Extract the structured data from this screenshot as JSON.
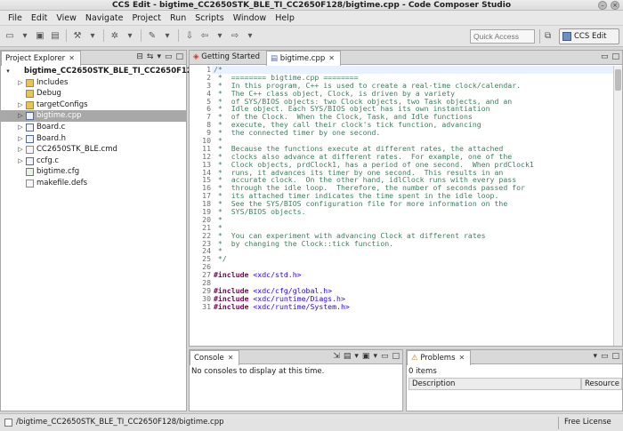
{
  "window": {
    "title": "CCS Edit - bigtime_CC2650STK_BLE_TI_CC2650F128/bigtime.cpp - Code Composer Studio"
  },
  "menu": [
    "File",
    "Edit",
    "View",
    "Navigate",
    "Project",
    "Run",
    "Scripts",
    "Window",
    "Help"
  ],
  "toolbar": {
    "quick_access_placeholder": "Quick Access",
    "perspective_label": "CCS Edit"
  },
  "project_explorer": {
    "tab_label": "Project Explorer",
    "items": [
      {
        "label": "bigtime_CC2650STK_BLE_TI_CC2650F128",
        "type": "project",
        "depth": 0,
        "expanded": true,
        "bold": true
      },
      {
        "label": "Includes",
        "type": "folder",
        "depth": 1,
        "expanded": false
      },
      {
        "label": "Debug",
        "type": "folder",
        "depth": 1,
        "expanded": null
      },
      {
        "label": "targetConfigs",
        "type": "folder",
        "depth": 1,
        "expanded": false
      },
      {
        "label": "bigtime.cpp",
        "type": "cfile",
        "depth": 1,
        "expanded": false,
        "selected": true
      },
      {
        "label": "Board.c",
        "type": "cfile",
        "depth": 1,
        "expanded": false
      },
      {
        "label": "Board.h",
        "type": "cfile",
        "depth": 1,
        "expanded": false
      },
      {
        "label": "CC2650STK_BLE.cmd",
        "type": "file",
        "depth": 1,
        "expanded": false
      },
      {
        "label": "ccfg.c",
        "type": "cfile",
        "depth": 1,
        "expanded": false
      },
      {
        "label": "bigtime.cfg",
        "type": "cfg",
        "depth": 1,
        "expanded": null
      },
      {
        "label": "makefile.defs",
        "type": "file",
        "depth": 1,
        "expanded": null
      }
    ]
  },
  "editor": {
    "tabs": [
      {
        "label": "Getting Started",
        "active": false
      },
      {
        "label": "bigtime.cpp",
        "active": true
      }
    ],
    "lines": [
      {
        "n": "1",
        "parts": [
          [
            "c",
            "/*"
          ]
        ]
      },
      {
        "n": "2",
        "parts": [
          [
            "c",
            " *  ======== bigtime.cpp ========"
          ]
        ]
      },
      {
        "n": "3",
        "parts": [
          [
            "c",
            " *  In this program, C++ is used to create a real-time clock/calendar."
          ]
        ]
      },
      {
        "n": "4",
        "parts": [
          [
            "c",
            " *  The C++ class object, Clock, is driven by a variety"
          ]
        ]
      },
      {
        "n": "5",
        "parts": [
          [
            "c",
            " *  of SYS/BIOS objects: two Clock objects, two Task objects, and an"
          ]
        ]
      },
      {
        "n": "6",
        "parts": [
          [
            "c",
            " *  Idle object. Each SYS/BIOS object has its own instantiation"
          ]
        ]
      },
      {
        "n": "7",
        "parts": [
          [
            "c",
            " *  of the Clock.  When the Clock, Task, and Idle functions"
          ]
        ]
      },
      {
        "n": "8",
        "parts": [
          [
            "c",
            " *  execute, they call their clock's tick function, advancing"
          ]
        ]
      },
      {
        "n": "9",
        "parts": [
          [
            "c",
            " *  the connected timer by one second."
          ]
        ]
      },
      {
        "n": "10",
        "parts": [
          [
            "c",
            " *"
          ]
        ]
      },
      {
        "n": "11",
        "parts": [
          [
            "c",
            " *  Because the functions execute at different rates, the attached"
          ]
        ]
      },
      {
        "n": "12",
        "parts": [
          [
            "c",
            " *  clocks also advance at different rates.  For example, one of the"
          ]
        ]
      },
      {
        "n": "13",
        "parts": [
          [
            "c",
            " *  Clock objects, prdClock1, has a period of one second.  When prdClock1"
          ]
        ]
      },
      {
        "n": "14",
        "parts": [
          [
            "c",
            " *  runs, it advances its timer by one second.  This results in an"
          ]
        ]
      },
      {
        "n": "15",
        "parts": [
          [
            "c",
            " *  accurate clock.  On the other hand, idlClock runs with every pass"
          ]
        ]
      },
      {
        "n": "16",
        "parts": [
          [
            "c",
            " *  through the idle loop.  Therefore, the number of seconds passed for"
          ]
        ]
      },
      {
        "n": "17",
        "parts": [
          [
            "c",
            " *  its attached timer indicates the time spent in the idle loop."
          ]
        ]
      },
      {
        "n": "18",
        "parts": [
          [
            "c",
            " *  See the SYS/BIOS configuration file for more information on the"
          ]
        ]
      },
      {
        "n": "19",
        "parts": [
          [
            "c",
            " *  SYS/BIOS objects."
          ]
        ]
      },
      {
        "n": "20",
        "parts": [
          [
            "c",
            " *"
          ]
        ]
      },
      {
        "n": "21",
        "parts": [
          [
            "c",
            " *"
          ]
        ]
      },
      {
        "n": "22",
        "parts": [
          [
            "c",
            " *  You can experiment with advancing Clock at different rates"
          ]
        ]
      },
      {
        "n": "23",
        "parts": [
          [
            "c",
            " *  by changing the Clock::tick function."
          ]
        ]
      },
      {
        "n": "24",
        "parts": [
          [
            "c",
            " *"
          ]
        ]
      },
      {
        "n": "25",
        "parts": [
          [
            "c",
            " */"
          ]
        ]
      },
      {
        "n": "26",
        "parts": []
      },
      {
        "n": "27",
        "parts": [
          [
            "kw",
            "#include"
          ],
          [
            "",
            " "
          ],
          [
            "str",
            "<xdc/std.h>"
          ]
        ]
      },
      {
        "n": "28",
        "parts": []
      },
      {
        "n": "29",
        "parts": [
          [
            "kw",
            "#include"
          ],
          [
            "",
            " "
          ],
          [
            "str",
            "<xdc/cfg/global.h>"
          ]
        ]
      },
      {
        "n": "30",
        "parts": [
          [
            "kw",
            "#include"
          ],
          [
            "",
            " "
          ],
          [
            "str",
            "<xdc/runtime/Diags.h>"
          ]
        ]
      },
      {
        "n": "31",
        "parts": [
          [
            "kw",
            "#include"
          ],
          [
            "",
            " "
          ],
          [
            "str",
            "<xdc/runtime/System.h>"
          ]
        ]
      }
    ]
  },
  "console": {
    "tab_label": "Console",
    "message": "No consoles to display at this time."
  },
  "problems": {
    "tab_label": "Problems",
    "count_text": "0 items",
    "columns": [
      "Description",
      "Resource"
    ]
  },
  "status": {
    "path": "/bigtime_CC2650STK_BLE_TI_CC2650F128/bigtime.cpp",
    "license": "Free License"
  },
  "colors": {
    "comment": "#3f7f5f",
    "keyword": "#7f0055",
    "string": "#2a00ff",
    "selection": "#a8a8a8"
  }
}
